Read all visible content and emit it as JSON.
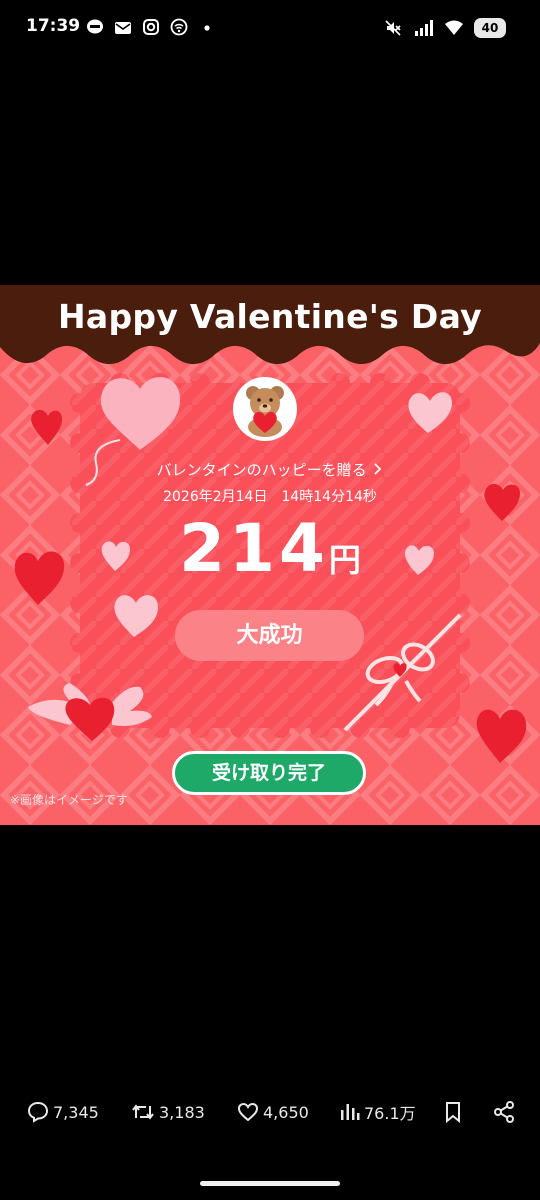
{
  "status_bar": {
    "time": "17:39",
    "left_icons": [
      "line-icon",
      "mail-icon",
      "instagram-icon",
      "connection-icon",
      "dot-icon"
    ],
    "right_icons": [
      "mute-icon",
      "signal-icon",
      "wifi-icon"
    ],
    "battery": "40"
  },
  "post_image": {
    "banner_title": "Happy Valentine's Day",
    "gift_link": "バレンタインのハッピーを贈る",
    "gift_link_icon": "chevron-right-icon",
    "gift_date": "2026年2月14日　14時14分14秒",
    "amount": "214",
    "currency": "円",
    "result": "大成功",
    "received_button": "受け取り完了",
    "disclaimer": "※画像はイメージです",
    "colors": {
      "background": "#fa6267",
      "chocolate": "#4a1d0c",
      "card": "#f9505a",
      "received_button": "#1ea969"
    }
  },
  "actions": {
    "replies": "7,345",
    "reposts": "3,183",
    "likes": "4,650",
    "views": "76.1万"
  }
}
